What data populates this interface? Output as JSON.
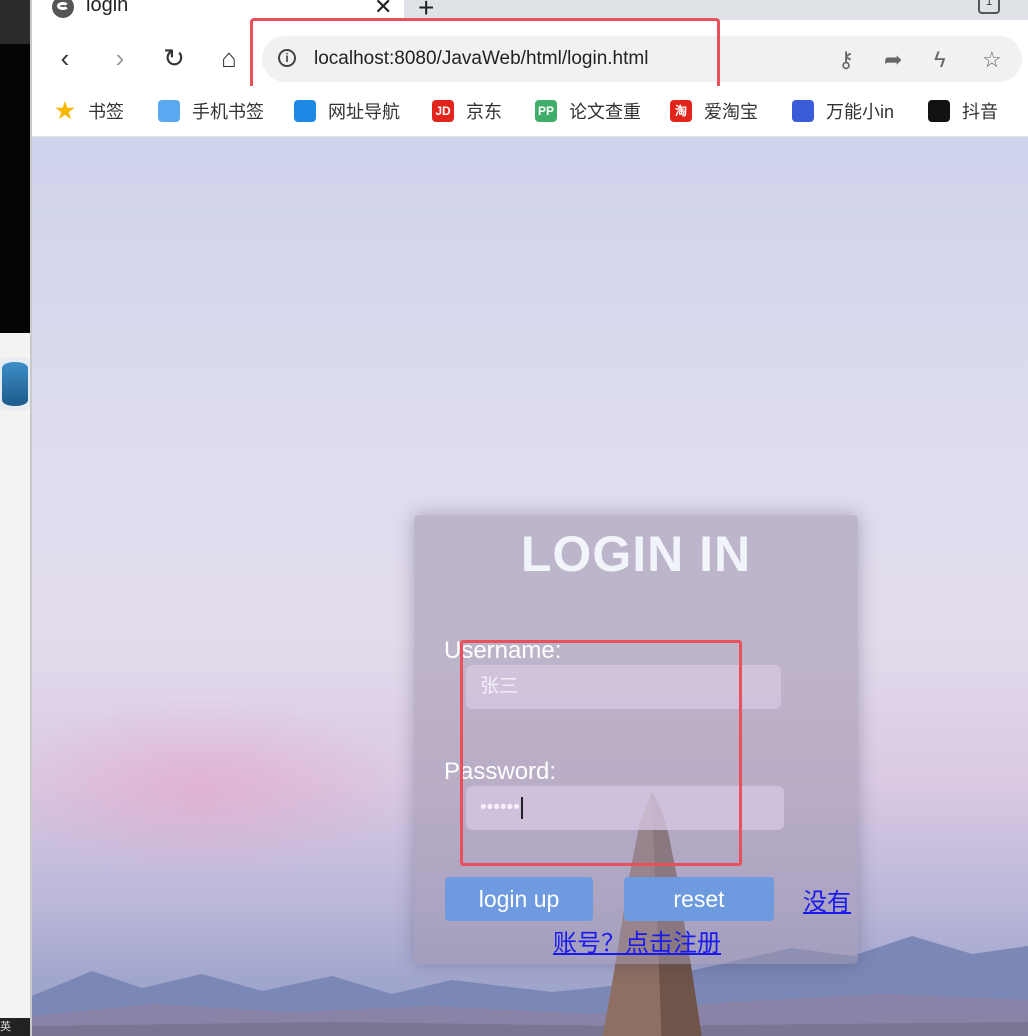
{
  "tab": {
    "title": "login",
    "close": "✕",
    "new": "+"
  },
  "toolbar": {
    "back": "‹",
    "forward": "›",
    "reload": "↻",
    "home": "⌂"
  },
  "address": {
    "info": "i",
    "url": "localhost:8080/JavaWeb/html/login.html"
  },
  "bookmarks": [
    {
      "label": "书签",
      "icon": "star-icon",
      "color": "#f5b800"
    },
    {
      "label": "手机书签",
      "icon": "phone-icon",
      "color": "#5aa8f0"
    },
    {
      "label": "网址导航",
      "icon": "browser-e-icon",
      "color": "#1e88e5"
    },
    {
      "label": "京东",
      "icon": "jd-icon",
      "color": "#e1251b",
      "glyph": "JD"
    },
    {
      "label": "论文查重",
      "icon": "pp-icon",
      "color": "#3fae6a",
      "glyph": "PP"
    },
    {
      "label": "爱淘宝",
      "icon": "taobao-icon",
      "color": "#e1251b",
      "glyph": "淘"
    },
    {
      "label": "万能小in",
      "icon": "robot-icon",
      "color": "#3b5bd8"
    },
    {
      "label": "抖音",
      "icon": "douyin-icon",
      "color": "#111111"
    }
  ],
  "login": {
    "heading": "LOGIN IN",
    "username_label": "Username:",
    "username_value": "张三",
    "password_label": "Password:",
    "password_value": "••••••",
    "login_button": "login up",
    "reset_button": "reset",
    "register_link_a": "没有",
    "register_link_b": "账号？点击注册"
  },
  "left_strip": {
    "footer_text": "英"
  },
  "colors": {
    "annotation_red": "#e8505b",
    "button_blue": "#6e9be0",
    "link_blue": "#1a1aee"
  }
}
